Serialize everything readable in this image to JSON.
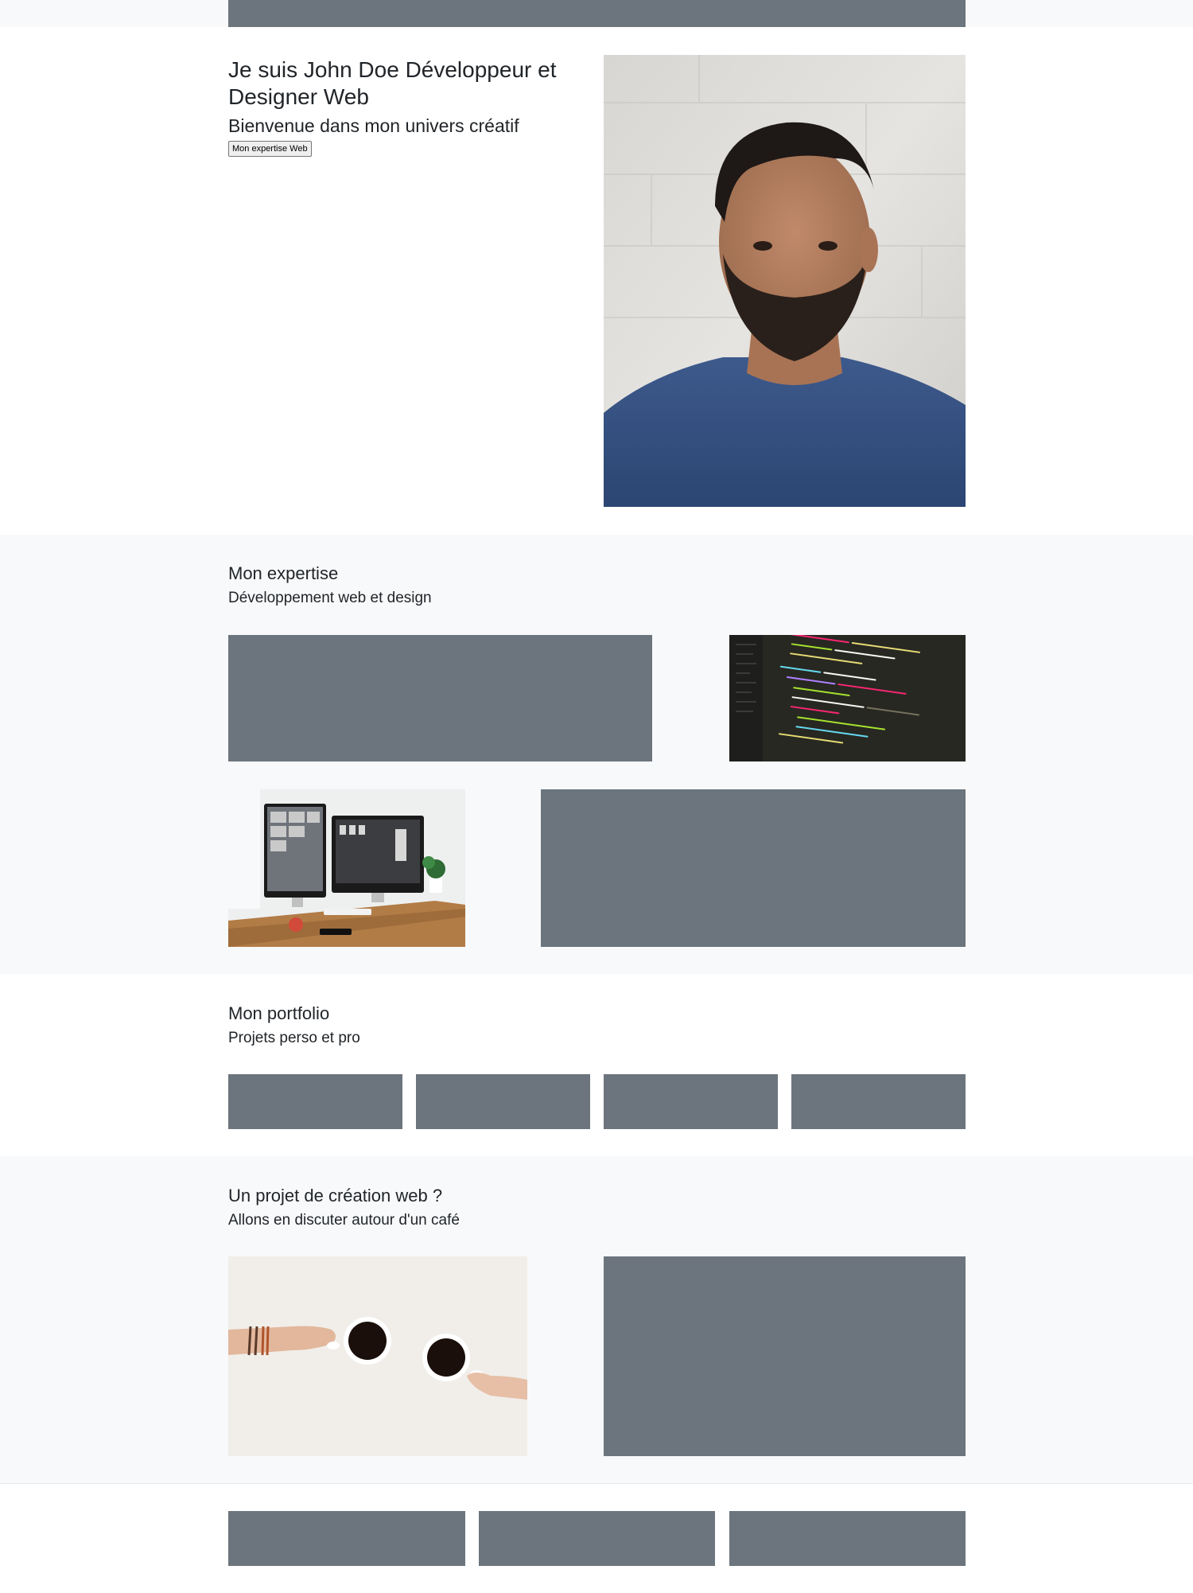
{
  "hero": {
    "title": "Je suis John Doe Développeur et Designer Web",
    "subtitle": "Bienvenue dans mon univers créatif",
    "button_label": "Mon expertise Web"
  },
  "expertise": {
    "title": "Mon expertise",
    "subtitle": "Développement web et design"
  },
  "portfolio": {
    "title": "Mon portfolio",
    "subtitle": "Projets perso et pro"
  },
  "contact": {
    "title": "Un projet de création web ?",
    "subtitle": "Allons en discuter autour d'un café"
  },
  "colors": {
    "placeholder_gray": "#6c757d",
    "light_band": "#f8f9fa"
  }
}
